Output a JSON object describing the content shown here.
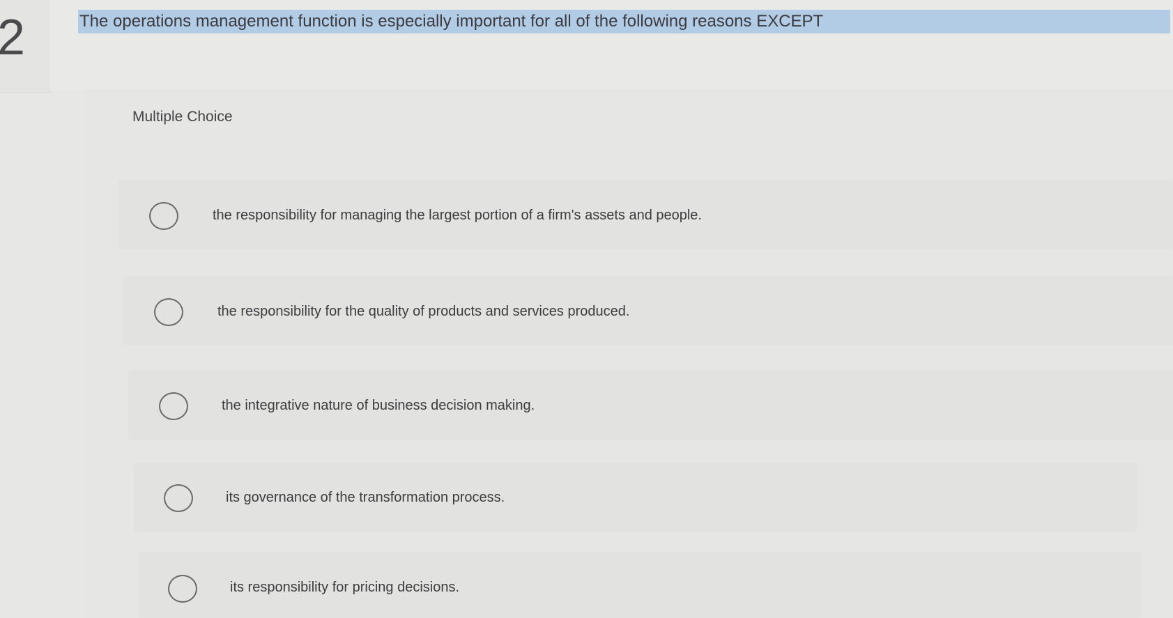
{
  "question": {
    "number": "2",
    "text": "The operations management function is especially important for all of the following reasons EXCEPT"
  },
  "answer_block": {
    "type_label": "Multiple Choice",
    "choices": [
      {
        "text": "the responsibility for managing the largest portion of a firm's assets and people.",
        "selected": false
      },
      {
        "text": "the responsibility for the quality of products and services produced.",
        "selected": false
      },
      {
        "text": "the integrative nature of business decision making.",
        "selected": false
      },
      {
        "text": "its governance of the transformation process.",
        "selected": false
      },
      {
        "text": "its responsibility for pricing decisions.",
        "selected": false
      }
    ]
  },
  "colors": {
    "question_highlight": "#b3cce6",
    "background": "#e7e7e5",
    "text": "#3a3a3c",
    "radio_border": "#6a6a6c"
  }
}
